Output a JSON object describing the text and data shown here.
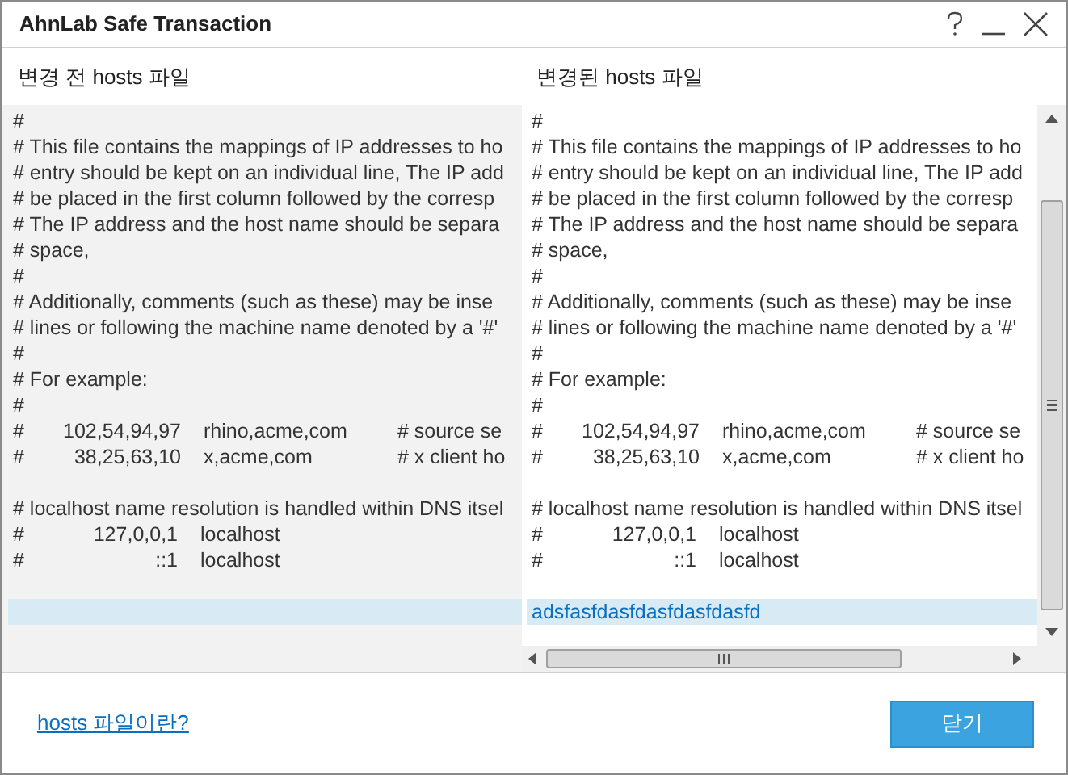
{
  "window": {
    "title": "AhnLab Safe Transaction"
  },
  "panes": [
    {
      "heading": "변경 전 hosts 파일",
      "lines": [
        {
          "kind": "text",
          "text": "#"
        },
        {
          "kind": "text",
          "text": "# This file contains the mappings of IP addresses to ho"
        },
        {
          "kind": "text",
          "text": "# entry should be kept on an individual line, The IP add"
        },
        {
          "kind": "text",
          "text": "# be placed in the first column followed by the corresp"
        },
        {
          "kind": "text",
          "text": "# The IP address and the host name should be separa"
        },
        {
          "kind": "text",
          "text": "# space,"
        },
        {
          "kind": "text",
          "text": "#"
        },
        {
          "kind": "text",
          "text": "# Additionally, comments (such as these) may be inse"
        },
        {
          "kind": "text",
          "text": "# lines or following the machine name denoted by a '#'"
        },
        {
          "kind": "text",
          "text": "#"
        },
        {
          "kind": "text",
          "text": "# For example:"
        },
        {
          "kind": "text",
          "text": "#"
        },
        {
          "kind": "entry",
          "cells": [
            "#",
            "102,54,94,97",
            "rhino,acme,com",
            "# source se"
          ]
        },
        {
          "kind": "entry",
          "cells": [
            "#",
            "38,25,63,10",
            "x,acme,com",
            "# x client ho"
          ]
        },
        {
          "kind": "blank"
        },
        {
          "kind": "text",
          "text": "# localhost name resolution is handled within DNS itsel"
        },
        {
          "kind": "entry",
          "cells": [
            "#",
            "127,0,0,1",
            "localhost"
          ]
        },
        {
          "kind": "entry",
          "cells": [
            "#",
            "::1",
            "localhost"
          ]
        },
        {
          "kind": "blank"
        },
        {
          "kind": "highlight"
        }
      ]
    },
    {
      "heading": "변경된 hosts 파일",
      "lines": [
        {
          "kind": "text",
          "text": "#"
        },
        {
          "kind": "text",
          "text": "# This file contains the mappings of IP addresses to ho"
        },
        {
          "kind": "text",
          "text": "# entry should be kept on an individual line, The IP add"
        },
        {
          "kind": "text",
          "text": "# be placed in the first column followed by the corresp"
        },
        {
          "kind": "text",
          "text": "# The IP address and the host name should be separa"
        },
        {
          "kind": "text",
          "text": "# space,"
        },
        {
          "kind": "text",
          "text": "#"
        },
        {
          "kind": "text",
          "text": "# Additionally, comments (such as these) may be inse"
        },
        {
          "kind": "text",
          "text": "# lines or following the machine name denoted by a '#'"
        },
        {
          "kind": "text",
          "text": "#"
        },
        {
          "kind": "text",
          "text": "# For example:"
        },
        {
          "kind": "text",
          "text": "#"
        },
        {
          "kind": "entry",
          "cells": [
            "#",
            "102,54,94,97",
            "rhino,acme,com",
            "# source se"
          ]
        },
        {
          "kind": "entry",
          "cells": [
            "#",
            "38,25,63,10",
            "x,acme,com",
            "# x client ho"
          ]
        },
        {
          "kind": "blank"
        },
        {
          "kind": "text",
          "text": "# localhost name resolution is handled within DNS itsel"
        },
        {
          "kind": "entry",
          "cells": [
            "#",
            "127,0,0,1",
            "localhost"
          ]
        },
        {
          "kind": "entry",
          "cells": [
            "#",
            "::1",
            "localhost"
          ]
        },
        {
          "kind": "blank"
        },
        {
          "kind": "highlight",
          "text": "adsfasfdasfdasfdasfdasfd"
        }
      ]
    }
  ],
  "footer": {
    "link": "hosts 파일이란?",
    "button": "닫기"
  }
}
